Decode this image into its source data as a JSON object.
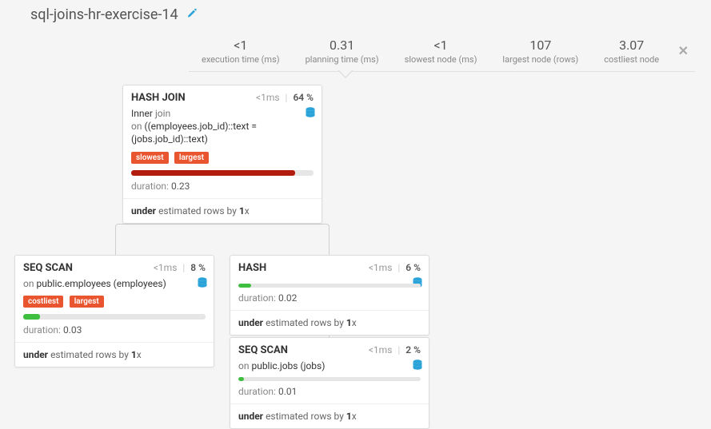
{
  "title": "sql-joins-hr-exercise-14",
  "summary": {
    "exec_time": {
      "value": "<1",
      "label": "execution time (ms)"
    },
    "plan_time": {
      "value": "0.31",
      "label": "planning time (ms)"
    },
    "slowest_node": {
      "value": "<1",
      "label": "slowest node (ms)"
    },
    "largest_node": {
      "value": "107",
      "label": "largest node (rows)"
    },
    "costliest_node": {
      "value": "3.07",
      "label": "costliest node"
    }
  },
  "strings": {
    "duration_label": "duration:",
    "under_est": "under",
    "est_rows_mid": "estimated rows by",
    "x_suffix": "x",
    "join_label": "join",
    "on_label": "on",
    "inner_label": "Inner"
  },
  "nodes": {
    "hash_join": {
      "title": "HASH JOIN",
      "ms": "<1ms",
      "pct": "64 %",
      "join_type": "Inner",
      "cond": "((employees.job_id)::text = (jobs.job_id)::text)",
      "tags": [
        "slowest",
        "largest"
      ],
      "bar_color": "#b11c0f",
      "bar_width": "90%",
      "duration": "0.23",
      "est_factor": "1"
    },
    "seq_emp": {
      "title": "SEQ SCAN",
      "ms": "<1ms",
      "pct": "8 %",
      "target": "public.employees (employees)",
      "tags": [
        "costliest",
        "largest"
      ],
      "bar_color": "#3fbf3f",
      "bar_width": "9%",
      "duration": "0.03",
      "est_factor": "1"
    },
    "hash": {
      "title": "HASH",
      "ms": "<1ms",
      "pct": "6 %",
      "bar_color": "#3fbf3f",
      "bar_width": "7%",
      "duration": "0.02",
      "est_factor": "1"
    },
    "seq_jobs": {
      "title": "SEQ SCAN",
      "ms": "<1ms",
      "pct": "2 %",
      "target": "public.jobs (jobs)",
      "bar_color": "#3fbf3f",
      "bar_width": "3%",
      "duration": "0.01",
      "est_factor": "1"
    }
  }
}
